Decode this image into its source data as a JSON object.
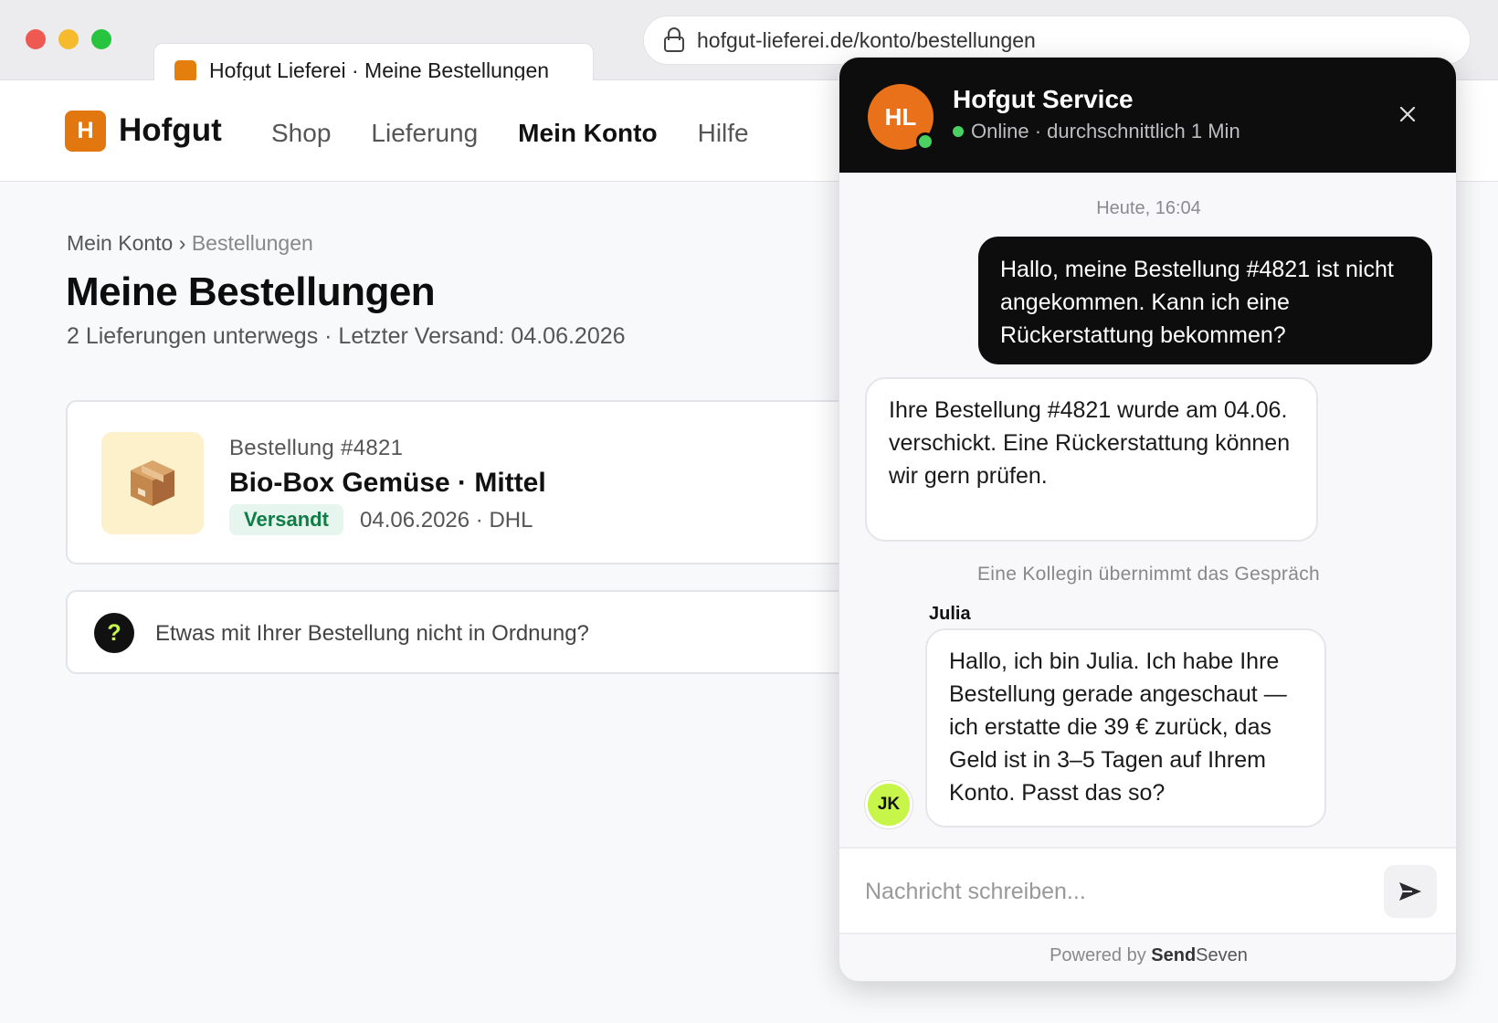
{
  "browser": {
    "tab_title": "Hofgut Lieferei · Meine Bestellungen",
    "url": "hofgut-lieferei.de/konto/bestellungen"
  },
  "site": {
    "logo_letter": "H",
    "logo_text": "Hofgut",
    "nav": [
      "Shop",
      "Lieferung",
      "Mein Konto",
      "Hilfe"
    ],
    "active_nav": "Mein Konto",
    "brand_color": "#e27710"
  },
  "page": {
    "breadcrumb_parent": "Mein Konto",
    "breadcrumb_sep": "›",
    "breadcrumb_current": "Bestellungen",
    "title": "Meine Bestellungen",
    "subtitle": "2 Lieferungen unterwegs · Letzter Versand: 04.06.2026"
  },
  "order": {
    "icon": "package-icon",
    "number": "Bestellung #4821",
    "name": "Bio-Box Gemüse · Mittel",
    "status": "Versandt",
    "meta": "04.06.2026 · DHL"
  },
  "help": {
    "icon_glyph": "?",
    "text": "Etwas mit Ihrer Bestellung nicht in Ordnung?"
  },
  "chat": {
    "avatar_initials": "HL",
    "title": "Hofgut Service",
    "status": "Online · durchschnittlich 1 Min",
    "timestamp": "Heute, 16:04",
    "messages": {
      "user": "Hallo, meine Bestellung #4821 ist nicht angekommen. Kann ich eine Rückerstattung bekommen?",
      "bot": "Ihre Bestellung #4821 wurde am 04.06. verschickt. Eine Rückerstattung können wir gern prüfen.",
      "system": "Eine Kollegin übernimmt das Gespräch",
      "agent_name": "Julia",
      "agent_initials": "JK",
      "agent": "Hallo, ich bin Julia. Ich habe Ihre Bestellung gerade angeschaut — ich erstatte die 39 € zurück, das Geld ist in 3–5 Tagen auf Ihrem Konto. Passt das so?"
    },
    "composer_placeholder": "Nachricht schreiben...",
    "powered_prefix": "Powered by ",
    "powered_brand_bold": "Send",
    "powered_brand_rest": "Seven"
  }
}
